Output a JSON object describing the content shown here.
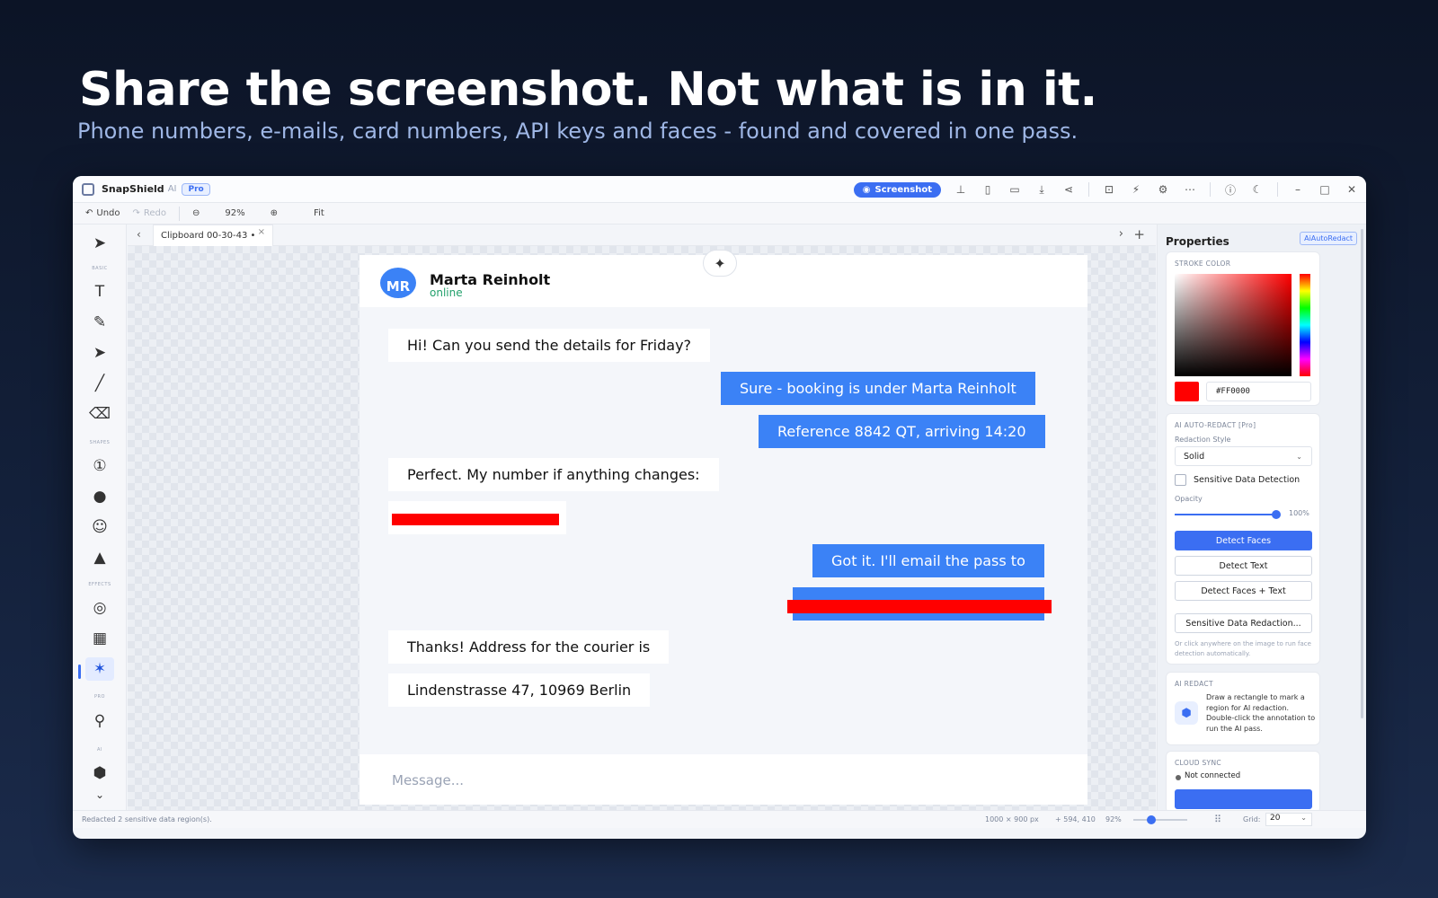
{
  "hero": {
    "title": "Share the screenshot. Not what is in it.",
    "subtitle": "Phone numbers, e-mails, card numbers, API keys and faces - found and covered in one pass."
  },
  "titlebar": {
    "app_name": "SnapShield",
    "app_ai": "AI",
    "pro_badge": "Pro",
    "screenshot_label": "Screenshot"
  },
  "toolbar": {
    "undo": "Undo",
    "redo": "Redo",
    "zoom": "92%",
    "fit": "Fit"
  },
  "toolgroups": [
    "BASIC",
    "SHAPES",
    "EFFECTS",
    "PRO",
    "AI"
  ],
  "tab": {
    "label": "Clipboard 00-30-43 •"
  },
  "chat": {
    "avatar": "MR",
    "name": "Marta Reinholt",
    "status": "online",
    "messages": [
      "Hi! Can you send the details for Friday?",
      "Sure - booking is under Marta Reinholt",
      "Reference 8842 QT, arriving 14:20",
      "Perfect. My number if anything changes:",
      "Got it. I'll email the pass to",
      "Thanks! Address for the courier is",
      "Lindenstrasse 47, 10969 Berlin"
    ],
    "placeholder": "Message..."
  },
  "properties": {
    "title": "Properties",
    "badge": "AiAutoRedact",
    "stroke_color_label": "STROKE COLOR",
    "color": "#FF0000",
    "color_hex": "#FF0000",
    "auto_redact_header": "AI AUTO-REDACT [Pro]",
    "redaction_style_label": "Redaction Style",
    "redaction_style": "Solid",
    "sensitive_detection": "Sensitive Data Detection",
    "opacity_label": "Opacity",
    "opacity": "100%",
    "opacity_value": 1.0,
    "btn_faces": "Detect Faces",
    "btn_text": "Detect Text",
    "btn_faces_text": "Detect Faces + Text",
    "btn_sensitive": "Sensitive Data Redaction...",
    "hint": "Or click anywhere on the image to run face detection automatically.",
    "ai_redact_header": "AI REDACT",
    "ai_redact_desc": "Draw a rectangle to mark a region for AI redaction. Double-click the annotation to run the AI pass.",
    "cloud_header": "CLOUD SYNC",
    "cloud_status": "Not connected"
  },
  "status": {
    "message": "Redacted 2 sensitive data region(s).",
    "dims": "1000 × 900 px",
    "coords": "+ 594, 410",
    "zoom": "92%",
    "zoom_value": 0.92,
    "grid_label": "Grid:",
    "grid_value": "20"
  }
}
